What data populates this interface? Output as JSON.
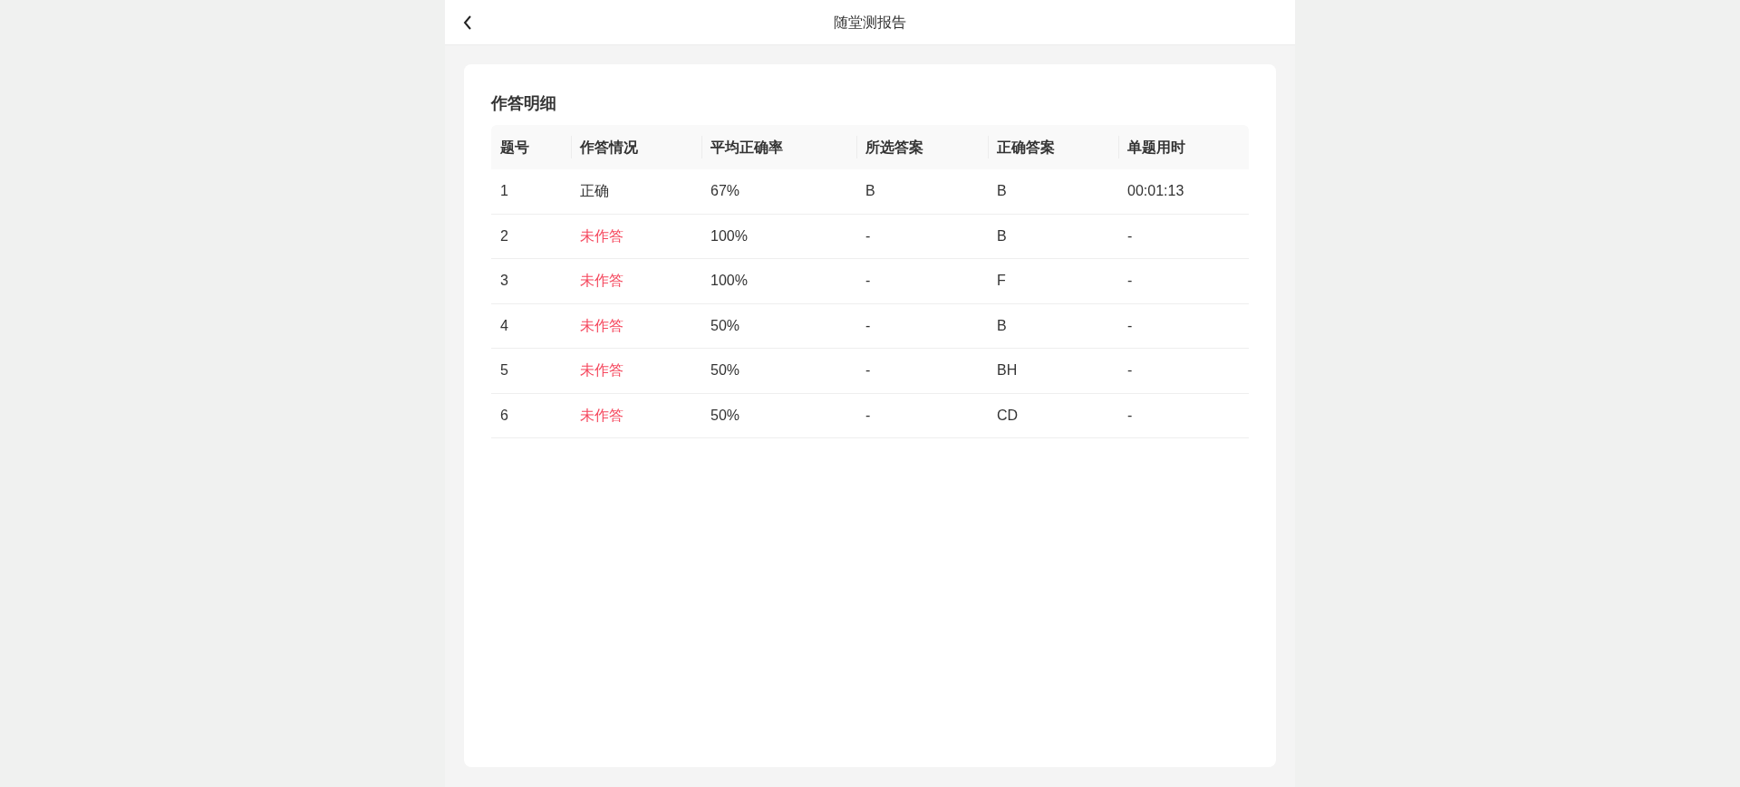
{
  "header": {
    "title": "随堂测报告"
  },
  "section": {
    "title": "作答明细"
  },
  "table": {
    "columns": [
      "题号",
      "作答情况",
      "平均正确率",
      "所选答案",
      "正确答案",
      "单题用时"
    ],
    "rows": [
      {
        "number": "1",
        "status": {
          "text": "正确",
          "kind": "correct"
        },
        "average": "67%",
        "selected_answer": "B",
        "correct_answer": "B",
        "time": "00:01:13"
      },
      {
        "number": "2",
        "status": {
          "text": "未作答",
          "kind": "unanswered"
        },
        "average": "100%",
        "selected_answer": "-",
        "correct_answer": "B",
        "time": "-"
      },
      {
        "number": "3",
        "status": {
          "text": "未作答",
          "kind": "unanswered"
        },
        "average": "100%",
        "selected_answer": "-",
        "correct_answer": "F",
        "time": "-"
      },
      {
        "number": "4",
        "status": {
          "text": "未作答",
          "kind": "unanswered"
        },
        "average": "50%",
        "selected_answer": "-",
        "correct_answer": "B",
        "time": "-"
      },
      {
        "number": "5",
        "status": {
          "text": "未作答",
          "kind": "unanswered"
        },
        "average": "50%",
        "selected_answer": "-",
        "correct_answer": "BH",
        "time": "-"
      },
      {
        "number": "6",
        "status": {
          "text": "未作答",
          "kind": "unanswered"
        },
        "average": "50%",
        "selected_answer": "-",
        "correct_answer": "CD",
        "time": "-"
      }
    ]
  }
}
